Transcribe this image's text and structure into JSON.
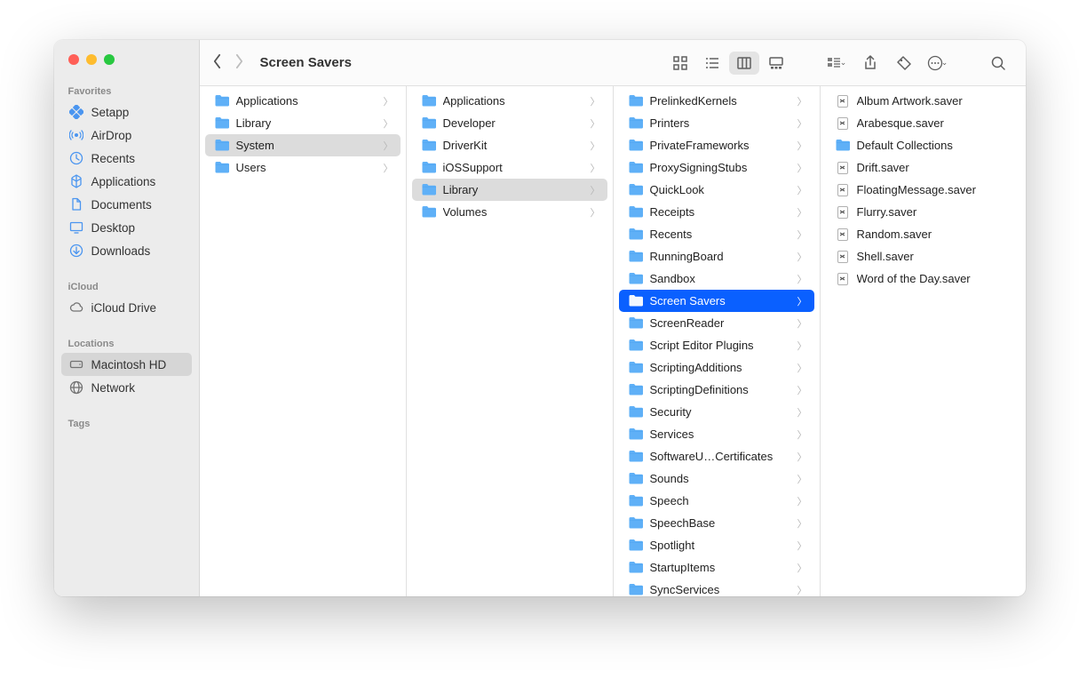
{
  "window_title": "Screen Savers",
  "sidebar": {
    "sections": [
      {
        "label": "Favorites",
        "items": [
          {
            "icon": "setapp",
            "label": "Setapp"
          },
          {
            "icon": "airdrop",
            "label": "AirDrop"
          },
          {
            "icon": "clock",
            "label": "Recents"
          },
          {
            "icon": "apps",
            "label": "Applications"
          },
          {
            "icon": "doc",
            "label": "Documents"
          },
          {
            "icon": "desktop",
            "label": "Desktop"
          },
          {
            "icon": "download",
            "label": "Downloads"
          }
        ]
      },
      {
        "label": "iCloud",
        "items": [
          {
            "icon": "cloud",
            "label": "iCloud Drive"
          }
        ]
      },
      {
        "label": "Locations",
        "items": [
          {
            "icon": "disk",
            "label": "Macintosh HD",
            "selected": true
          },
          {
            "icon": "network",
            "label": "Network"
          }
        ]
      },
      {
        "label": "Tags",
        "items": []
      }
    ]
  },
  "columns": [
    {
      "items": [
        {
          "type": "folder",
          "label": "Applications",
          "arrow": true
        },
        {
          "type": "folder",
          "label": "Library",
          "arrow": true
        },
        {
          "type": "folder",
          "label": "System",
          "arrow": true,
          "path_selected": true
        },
        {
          "type": "folder",
          "label": "Users",
          "arrow": true
        }
      ]
    },
    {
      "items": [
        {
          "type": "folder",
          "label": "Applications",
          "arrow": true
        },
        {
          "type": "folder",
          "label": "Developer",
          "arrow": true
        },
        {
          "type": "folder",
          "label": "DriverKit",
          "arrow": true
        },
        {
          "type": "folder",
          "label": "iOSSupport",
          "arrow": true
        },
        {
          "type": "folder",
          "label": "Library",
          "arrow": true,
          "path_selected": true
        },
        {
          "type": "folder",
          "label": "Volumes",
          "arrow": true
        }
      ]
    },
    {
      "items": [
        {
          "type": "folder",
          "label": "PrelinkedKernels",
          "arrow": true
        },
        {
          "type": "folder",
          "label": "Printers",
          "arrow": true
        },
        {
          "type": "folder",
          "label": "PrivateFrameworks",
          "arrow": true
        },
        {
          "type": "folder",
          "label": "ProxySigningStubs",
          "arrow": true
        },
        {
          "type": "folder",
          "label": "QuickLook",
          "arrow": true
        },
        {
          "type": "folder",
          "label": "Receipts",
          "arrow": true
        },
        {
          "type": "folder",
          "label": "Recents",
          "arrow": true
        },
        {
          "type": "folder",
          "label": "RunningBoard",
          "arrow": true
        },
        {
          "type": "folder",
          "label": "Sandbox",
          "arrow": true
        },
        {
          "type": "folder",
          "label": "Screen Savers",
          "arrow": true,
          "active_selected": true
        },
        {
          "type": "folder",
          "label": "ScreenReader",
          "arrow": true
        },
        {
          "type": "folder",
          "label": "Script Editor Plugins",
          "arrow": true
        },
        {
          "type": "folder",
          "label": "ScriptingAdditions",
          "arrow": true
        },
        {
          "type": "folder",
          "label": "ScriptingDefinitions",
          "arrow": true
        },
        {
          "type": "folder",
          "label": "Security",
          "arrow": true
        },
        {
          "type": "folder",
          "label": "Services",
          "arrow": true
        },
        {
          "type": "folder",
          "label": "SoftwareU…Certificates",
          "arrow": true
        },
        {
          "type": "folder",
          "label": "Sounds",
          "arrow": true
        },
        {
          "type": "folder",
          "label": "Speech",
          "arrow": true
        },
        {
          "type": "folder",
          "label": "SpeechBase",
          "arrow": true
        },
        {
          "type": "folder",
          "label": "Spotlight",
          "arrow": true
        },
        {
          "type": "folder",
          "label": "StartupItems",
          "arrow": true
        },
        {
          "type": "folder",
          "label": "SyncServices",
          "arrow": true
        }
      ]
    },
    {
      "items": [
        {
          "type": "file",
          "label": "Album Artwork.saver"
        },
        {
          "type": "file",
          "label": "Arabesque.saver"
        },
        {
          "type": "folder",
          "label": "Default Collections"
        },
        {
          "type": "file",
          "label": "Drift.saver"
        },
        {
          "type": "file",
          "label": "FloatingMessage.saver"
        },
        {
          "type": "file",
          "label": "Flurry.saver"
        },
        {
          "type": "file",
          "label": "Random.saver"
        },
        {
          "type": "file",
          "label": "Shell.saver"
        },
        {
          "type": "file",
          "label": "Word of the Day.saver"
        }
      ]
    }
  ]
}
